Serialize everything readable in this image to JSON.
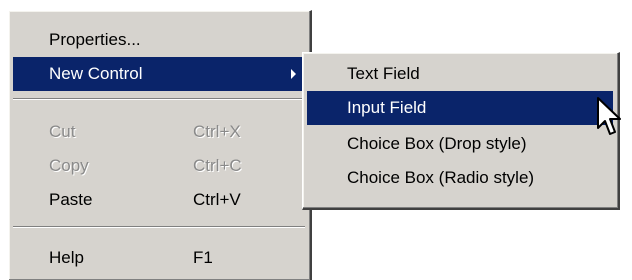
{
  "main_menu": {
    "properties": "Properties...",
    "new_control": "New Control",
    "cut": {
      "label": "Cut",
      "shortcut": "Ctrl+X"
    },
    "copy": {
      "label": "Copy",
      "shortcut": "Ctrl+C"
    },
    "paste": {
      "label": "Paste",
      "shortcut": "Ctrl+V"
    },
    "help": {
      "label": "Help",
      "shortcut": "F1"
    }
  },
  "submenu": {
    "items": [
      "Text Field",
      "Input Field",
      "Choice Box (Drop style)",
      "Choice Box (Radio style)"
    ]
  },
  "colors": {
    "highlight": "#0a246a",
    "menu_bg": "#d6d3ce"
  },
  "cursor_icon": "arrow-pointer-icon",
  "submenu_arrow_icon": "triangle-right-icon"
}
